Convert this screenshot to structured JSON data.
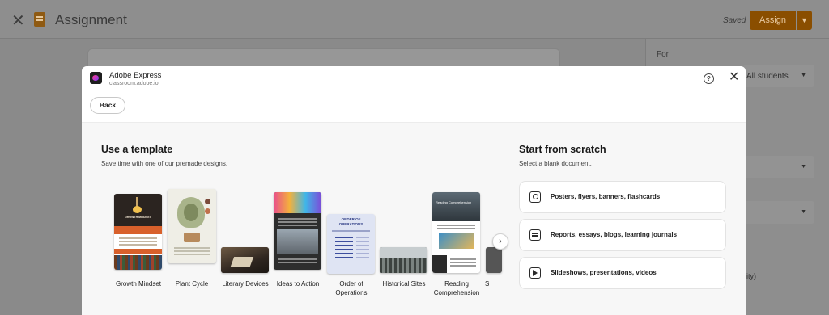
{
  "app": {
    "title": "Assignment",
    "saved_label": "Saved",
    "assign_label": "Assign"
  },
  "sidepanel": {
    "for_label": "For",
    "students_value": "All students",
    "truncated_text": "ility)"
  },
  "modal": {
    "app_name": "Adobe Express",
    "url": "classroom.adobe.io",
    "back_label": "Back",
    "template_section": {
      "heading": "Use a template",
      "subheading": "Save time with one of our premade designs.",
      "items": [
        {
          "label": "Growth Mindset",
          "thumb_title": "GROWTH MINDSET"
        },
        {
          "label": "Plant Cycle"
        },
        {
          "label": "Literary Devices"
        },
        {
          "label": "Ideas to Action"
        },
        {
          "label": "Order of Operations",
          "thumb_title": "ORDER OF OPERATIONS"
        },
        {
          "label": "Historical Sites"
        },
        {
          "label": "Reading Comprehension",
          "thumb_title": "Reading Comprehension"
        },
        {
          "label": "S"
        }
      ]
    },
    "scratch_section": {
      "heading": "Start from scratch",
      "subheading": "Select a blank document.",
      "options": [
        {
          "label": "Posters, flyers, banners, flashcards",
          "icon": "poster-icon"
        },
        {
          "label": "Reports, essays, blogs, learning journals",
          "icon": "document-icon"
        },
        {
          "label": "Slideshows, presentations, videos",
          "icon": "video-icon"
        }
      ]
    }
  },
  "colors": {
    "assign_button": "#8a4e00",
    "overlay": "#8a8a8a",
    "modal_bg": "#ffffff",
    "content_bg": "#f7f7f7"
  }
}
